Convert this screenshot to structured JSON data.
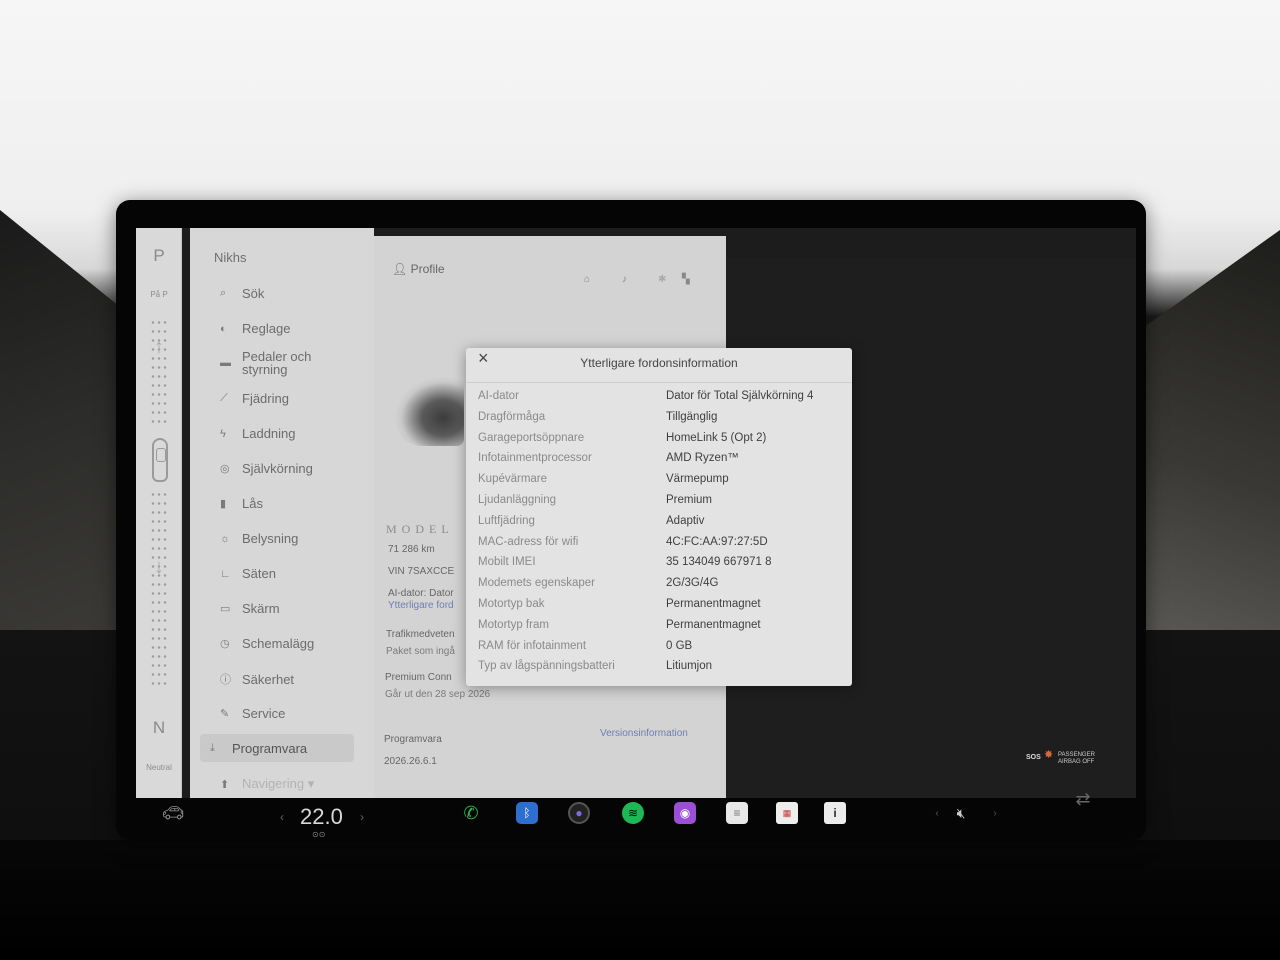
{
  "gear": {
    "p": "P",
    "p_sub": "På P",
    "n": "N",
    "n_sub": "Neutral"
  },
  "menu": {
    "owner": "Nikhs",
    "items": [
      {
        "icon": "⌕",
        "label": "Sök"
      },
      {
        "icon": "◐",
        "label": "Reglage"
      },
      {
        "icon": "▬",
        "label": "Pedaler och\nstyrning"
      },
      {
        "icon": "⟋",
        "label": "Fjädring"
      },
      {
        "icon": "ϟ",
        "label": "Laddning"
      },
      {
        "icon": "◎",
        "label": "Självkörning"
      },
      {
        "icon": "▮",
        "label": "Lås"
      },
      {
        "icon": "☼",
        "label": "Belysning"
      },
      {
        "icon": "∟",
        "label": "Säten"
      },
      {
        "icon": "▭",
        "label": "Skärm"
      },
      {
        "icon": "◷",
        "label": "Schemalägg"
      },
      {
        "icon": "ⓘ",
        "label": "Säkerhet"
      },
      {
        "icon": "✎",
        "label": "Service"
      },
      {
        "icon": "⤓",
        "label": "Programvara"
      },
      {
        "icon": "⬆",
        "label": "Navigering ▾"
      }
    ]
  },
  "content": {
    "profile_label": "Profile",
    "model_logo": "MODEL",
    "odometer": "71 286  km",
    "vin": "VIN 7SAXCCE",
    "ai_line": "AI-dator: Dator",
    "more_info_link": "Ytterligare ford",
    "traffic_title": "Trafikmedveten",
    "traffic_sub": "Paket som ingå",
    "premium_title": "Premium Conn",
    "premium_sub": "Går ut den 28 sep 2026",
    "software_title": "Programvara",
    "software_version": "2026.26.6.1",
    "version_link": "Versionsinformation"
  },
  "dialog": {
    "title": "Ytterligare fordonsinformation",
    "close_icon": "close-icon",
    "rows": [
      {
        "label": "AI-dator",
        "value": "Dator för Total Självkörning 4"
      },
      {
        "label": "Dragförmåga",
        "value": "Tillgänglig"
      },
      {
        "label": "Garageportsöppnare",
        "value": "HomeLink 5 (Opt 2)"
      },
      {
        "label": "Infotainmentprocessor",
        "value": "AMD Ryzen™"
      },
      {
        "label": "Kupévärmare",
        "value": "Värmepump"
      },
      {
        "label": "Ljudanläggning",
        "value": "Premium"
      },
      {
        "label": "Luftfjädring",
        "value": "Adaptiv"
      },
      {
        "label": "MAC-adress för wifi",
        "value": "4C:FC:AA:97:27:5D"
      },
      {
        "label": "Mobilt IMEI",
        "value": "35 134049 667971 8"
      },
      {
        "label": "Modemets egenskaper",
        "value": "2G/3G/4G"
      },
      {
        "label": "Motortyp bak",
        "value": "Permanentmagnet"
      },
      {
        "label": "Motortyp fram",
        "value": "Permanentmagnet"
      },
      {
        "label": "RAM för infotainment",
        "value": "0 GB"
      },
      {
        "label": "Typ av lågspänningsbatteri",
        "value": "Litiumjon"
      }
    ]
  },
  "status": {
    "sos": "SOS",
    "airbag_line1": "PASSENGER",
    "airbag_line2": "AIRBAG OFF"
  },
  "taskbar": {
    "temperature": "22.0",
    "icons": [
      "car-icon",
      "phone-icon",
      "bluetooth-icon",
      "camera-icon",
      "spotify-icon",
      "podcasts-icon",
      "notes-icon",
      "calendar-icon",
      "info-icon",
      "mute-icon",
      "swap-icon"
    ]
  },
  "colors": {
    "phone": "#2db84d",
    "bluetooth": "#2d6fd0",
    "spotify": "#1db954",
    "podcasts": "#9b4fd6",
    "accent_link": "#6f7fb4"
  }
}
